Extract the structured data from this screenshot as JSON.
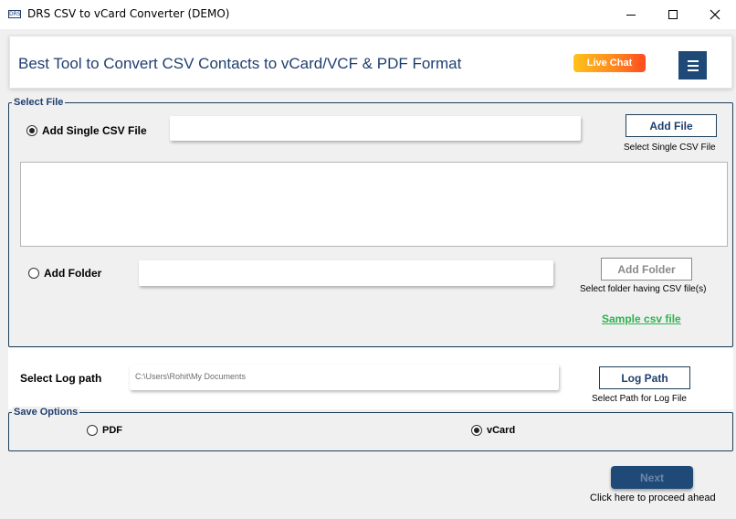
{
  "window": {
    "title": "DRS CSV to vCard Converter (DEMO)",
    "icon_text": "DRS"
  },
  "header": {
    "headline": "Best Tool to Convert CSV Contacts to vCard/VCF & PDF Format",
    "live_chat": "Live Chat"
  },
  "select_file": {
    "group_label": "Select File",
    "single_csv_label": "Add Single CSV File",
    "single_csv_path": "",
    "add_file_button": "Add File",
    "add_file_hint": "Select Single CSV File",
    "add_folder_label": "Add Folder",
    "folder_path": "",
    "add_folder_button": "Add Folder",
    "add_folder_hint": "Select folder having CSV file(s)",
    "sample_link": "Sample csv file"
  },
  "log": {
    "label": "Select Log path",
    "path": "C:\\Users\\Rohit\\My Documents",
    "button": "Log Path",
    "hint": "Select Path for Log File"
  },
  "save_options": {
    "group_label": "Save Options",
    "pdf_label": "PDF",
    "vcard_label": "vCard",
    "selected": "vCard"
  },
  "footer": {
    "next_button": "Next",
    "next_hint": "Click here to proceed ahead"
  },
  "colors": {
    "brand_navy": "#1f4a78",
    "headline_blue": "#1f3f6e",
    "link_green": "#2eb34f",
    "live_chat_orange": "#ff8a1f"
  }
}
